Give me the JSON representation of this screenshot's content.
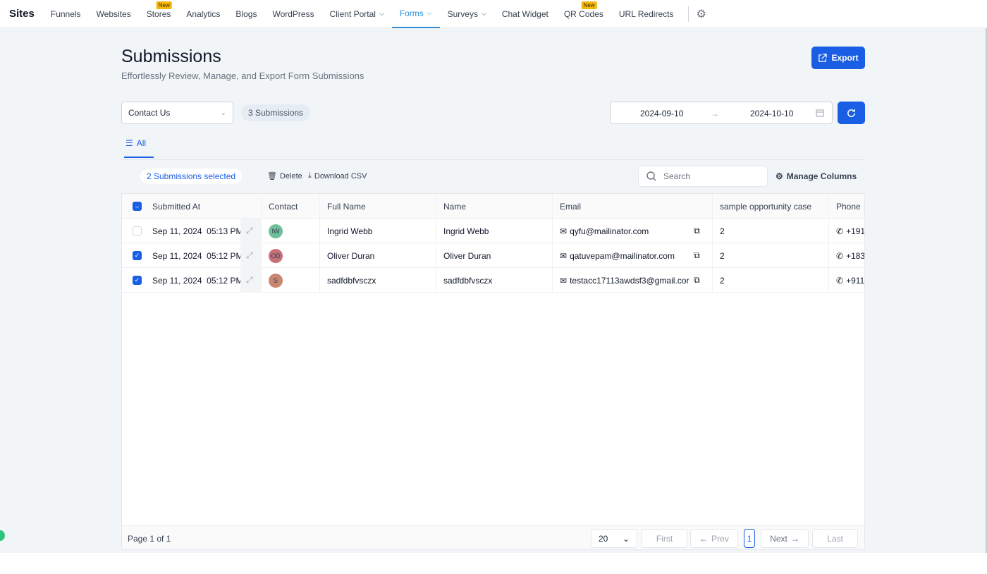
{
  "nav": {
    "brand": "Sites",
    "items": [
      {
        "label": "Funnels"
      },
      {
        "label": "Websites"
      },
      {
        "label": "Stores",
        "badge": "New"
      },
      {
        "label": "Analytics"
      },
      {
        "label": "Blogs"
      },
      {
        "label": "WordPress"
      },
      {
        "label": "Client Portal",
        "dropdown": true
      },
      {
        "label": "Forms",
        "dropdown": true,
        "active": true
      },
      {
        "label": "Surveys",
        "dropdown": true
      },
      {
        "label": "Chat Widget"
      },
      {
        "label": "QR Codes",
        "badge": "New"
      },
      {
        "label": "URL Redirects"
      }
    ]
  },
  "page": {
    "title": "Submissions",
    "subtitle": "Effortlessly Review, Manage, and Export Form Submissions",
    "export_label": "Export"
  },
  "filters": {
    "form": "Contact Us",
    "count": "3 Submissions",
    "start_date": "2024-09-10",
    "end_date": "2024-10-10"
  },
  "tabs": [
    {
      "label": "All"
    }
  ],
  "toolbar": {
    "selected": "2 Submissions selected",
    "delete": "Delete",
    "download": "Download CSV",
    "search_placeholder": "Search",
    "manage_columns": "Manage Columns"
  },
  "table": {
    "columns": [
      "Submitted At",
      "Contact",
      "Full Name",
      "Name",
      "Email",
      "sample opportunity case",
      "Phone"
    ],
    "rows": [
      {
        "checked": false,
        "submitted": "Sep 11, 2024  05:13 PM",
        "initials": "IW",
        "avatar_color": "#6fbf9b",
        "full_name": "Ingrid Webb",
        "name": "Ingrid Webb",
        "email": "qyfu@mailinator.com",
        "case": "2",
        "phone": "+191"
      },
      {
        "checked": true,
        "submitted": "Sep 11, 2024  05:12 PM",
        "initials": "OD",
        "avatar_color": "#c8707a",
        "full_name": "Oliver Duran",
        "name": "Oliver Duran",
        "email": "qatuvepam@mailinator.com",
        "case": "2",
        "phone": "+183"
      },
      {
        "checked": true,
        "submitted": "Sep 11, 2024  05:12 PM",
        "initials": "S",
        "avatar_color": "#c98570",
        "full_name": "sadfdbfvsczx",
        "name": "sadfdbfvsczx",
        "email": "testacc17113awdsf3@gmail.cor",
        "case": "2",
        "phone": "+911"
      }
    ]
  },
  "pagination": {
    "page_text": "Page 1 of 1",
    "page_size": "20",
    "first": "First",
    "prev": "Prev",
    "current": "1",
    "next": "Next",
    "last": "Last"
  },
  "colors": {
    "accent": "#1a5ee6",
    "nav_active": "#2a8fd8"
  }
}
